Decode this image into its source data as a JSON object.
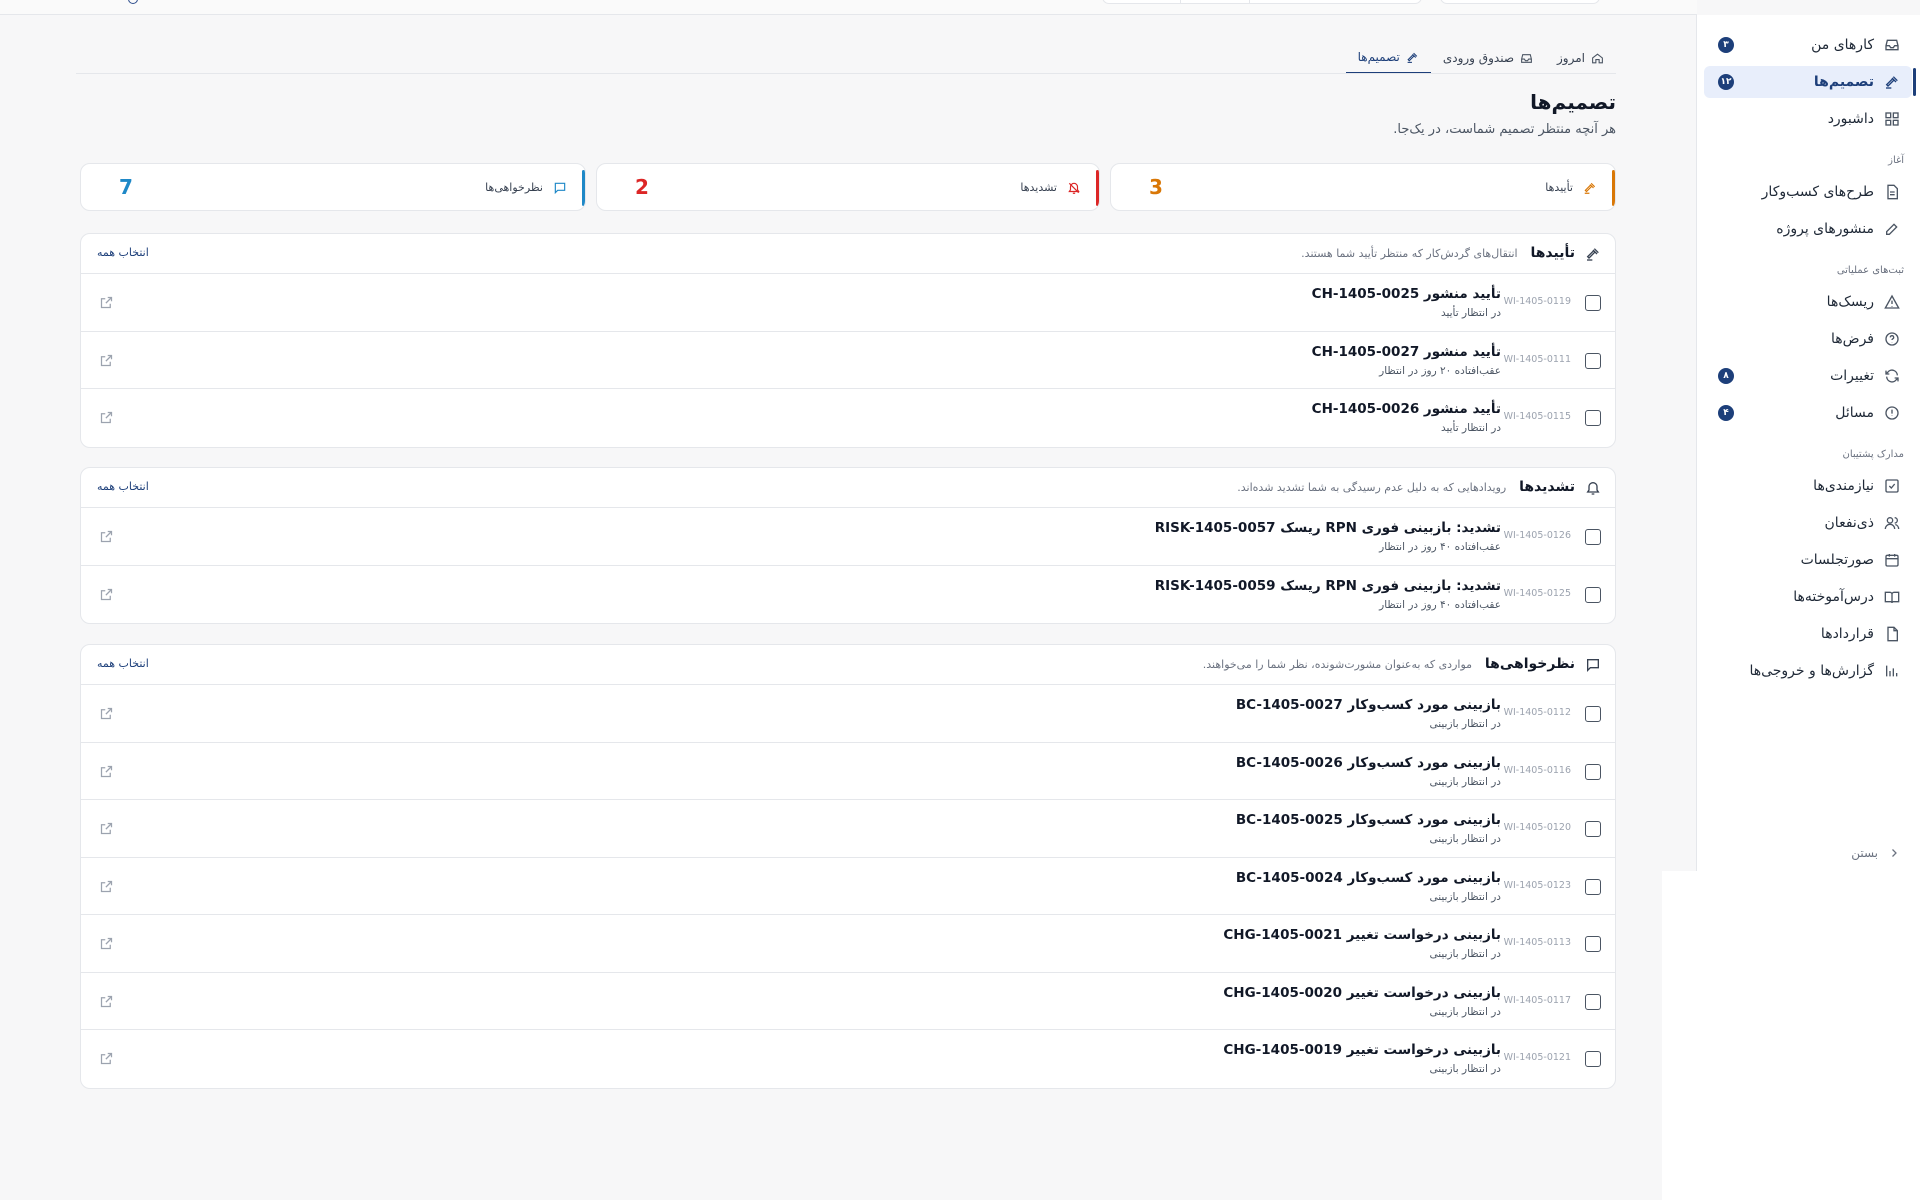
{
  "sidebar": {
    "items": [
      {
        "label": "کارهای من",
        "icon": "inbox-icon",
        "badge": "۳"
      },
      {
        "label": "تصمیم‌ها",
        "icon": "gavel-icon",
        "badge": "۱۲",
        "active": true
      },
      {
        "label": "داشبورد",
        "icon": "dashboard-icon"
      },
      {
        "label": "طرح‌های کسب‌وکار",
        "icon": "document-icon"
      },
      {
        "label": "منشورهای پروژه",
        "icon": "edit-icon"
      },
      {
        "label": "ریسک‌ها",
        "icon": "warning-icon"
      },
      {
        "label": "فرض‌ها",
        "icon": "help-circle-icon"
      },
      {
        "label": "تغییرات",
        "icon": "refresh-icon",
        "badge": "۸"
      },
      {
        "label": "مسائل",
        "icon": "alert-circle-icon",
        "badge": "۴"
      },
      {
        "label": "نیازمندی‌ها",
        "icon": "checkbox-icon"
      },
      {
        "label": "ذی‌نفعان",
        "icon": "users-icon"
      },
      {
        "label": "صورتجلسات",
        "icon": "calendar-icon"
      },
      {
        "label": "درس‌آموخته‌ها",
        "icon": "book-icon"
      },
      {
        "label": "قراردادها",
        "icon": "file-icon"
      },
      {
        "label": "گزارش‌ها و خروجی‌ها",
        "icon": "chart-icon"
      }
    ],
    "groups": [
      "آغاز",
      "ثبت‌های عملیاتی",
      "مدارک پشتیبان"
    ],
    "collapse_label": "بستن"
  },
  "tabs": [
    {
      "label": "امروز",
      "icon": "home-icon"
    },
    {
      "label": "صندوق ورودی",
      "icon": "inbox-icon"
    },
    {
      "label": "تصمیم‌ها",
      "icon": "gavel-icon",
      "active": true
    }
  ],
  "page": {
    "title": "تصمیم‌ها",
    "subtitle": "هر آنچه منتظر تصمیم شماست، در یک‌جا."
  },
  "stats": [
    {
      "label": "تأییدها",
      "value": "3",
      "color": "#d97706",
      "icon": "gavel-icon"
    },
    {
      "label": "تشدیدها",
      "value": "2",
      "color": "#dc2626",
      "icon": "bell-icon"
    },
    {
      "label": "نظرخواهی‌ها",
      "value": "7",
      "color": "#1e88c7",
      "icon": "message-icon"
    }
  ],
  "sections": {
    "approvals": {
      "title": "تأییدها",
      "desc": "انتقال‌های گردش‌کار که منتظر تأیید شما هستند.",
      "select_all": "انتخاب همه",
      "rows": [
        {
          "id": "WI-1405-0119",
          "title": "تأیید منشور CH-1405-0025",
          "status": "در انتظار تأیید"
        },
        {
          "id": "WI-1405-0111",
          "title": "تأیید منشور CH-1405-0027",
          "status": "عقب‌افتاده ۲۰ روز در انتظار"
        },
        {
          "id": "WI-1405-0115",
          "title": "تأیید منشور CH-1405-0026",
          "status": "در انتظار تأیید"
        }
      ]
    },
    "escalations": {
      "title": "تشدیدها",
      "desc": "رویدادهایی که به دلیل عدم رسیدگی به شما تشدید شده‌اند.",
      "select_all": "انتخاب همه",
      "rows": [
        {
          "id": "WI-1405-0126",
          "title": "تشدید: بازبینی فوری RPN ریسک RISK-1405-0057",
          "status": "عقب‌افتاده ۴۰ روز در انتظار"
        },
        {
          "id": "WI-1405-0125",
          "title": "تشدید: بازبینی فوری RPN ریسک RISK-1405-0059",
          "status": "عقب‌افتاده ۴۰ روز در انتظار"
        }
      ]
    },
    "consultations": {
      "title": "نظرخواهی‌ها",
      "desc": "مواردی که به‌عنوان مشورت‌شونده، نظر شما را می‌خواهند.",
      "select_all": "انتخاب همه",
      "rows": [
        {
          "id": "WI-1405-0112",
          "title": "بازبینی مورد کسب‌وکار BC-1405-0027",
          "status": "در انتظار بازبینی"
        },
        {
          "id": "WI-1405-0116",
          "title": "بازبینی مورد کسب‌وکار BC-1405-0026",
          "status": "در انتظار بازبینی"
        },
        {
          "id": "WI-1405-0120",
          "title": "بازبینی مورد کسب‌وکار BC-1405-0025",
          "status": "در انتظار بازبینی"
        },
        {
          "id": "WI-1405-0123",
          "title": "بازبینی مورد کسب‌وکار BC-1405-0024",
          "status": "در انتظار بازبینی"
        },
        {
          "id": "WI-1405-0113",
          "title": "بازبینی درخواست تغییر CHG-1405-0021",
          "status": "در انتظار بازبینی"
        },
        {
          "id": "WI-1405-0117",
          "title": "بازبینی درخواست تغییر CHG-1405-0020",
          "status": "در انتظار بازبینی"
        },
        {
          "id": "WI-1405-0121",
          "title": "بازبینی درخواست تغییر CHG-1405-0019",
          "status": "در انتظار بازبینی"
        }
      ]
    }
  },
  "colors": {
    "brand": "#1d3f7a",
    "approvals": "#d97706",
    "escalations": "#dc2626",
    "consultations": "#1e88c7"
  }
}
